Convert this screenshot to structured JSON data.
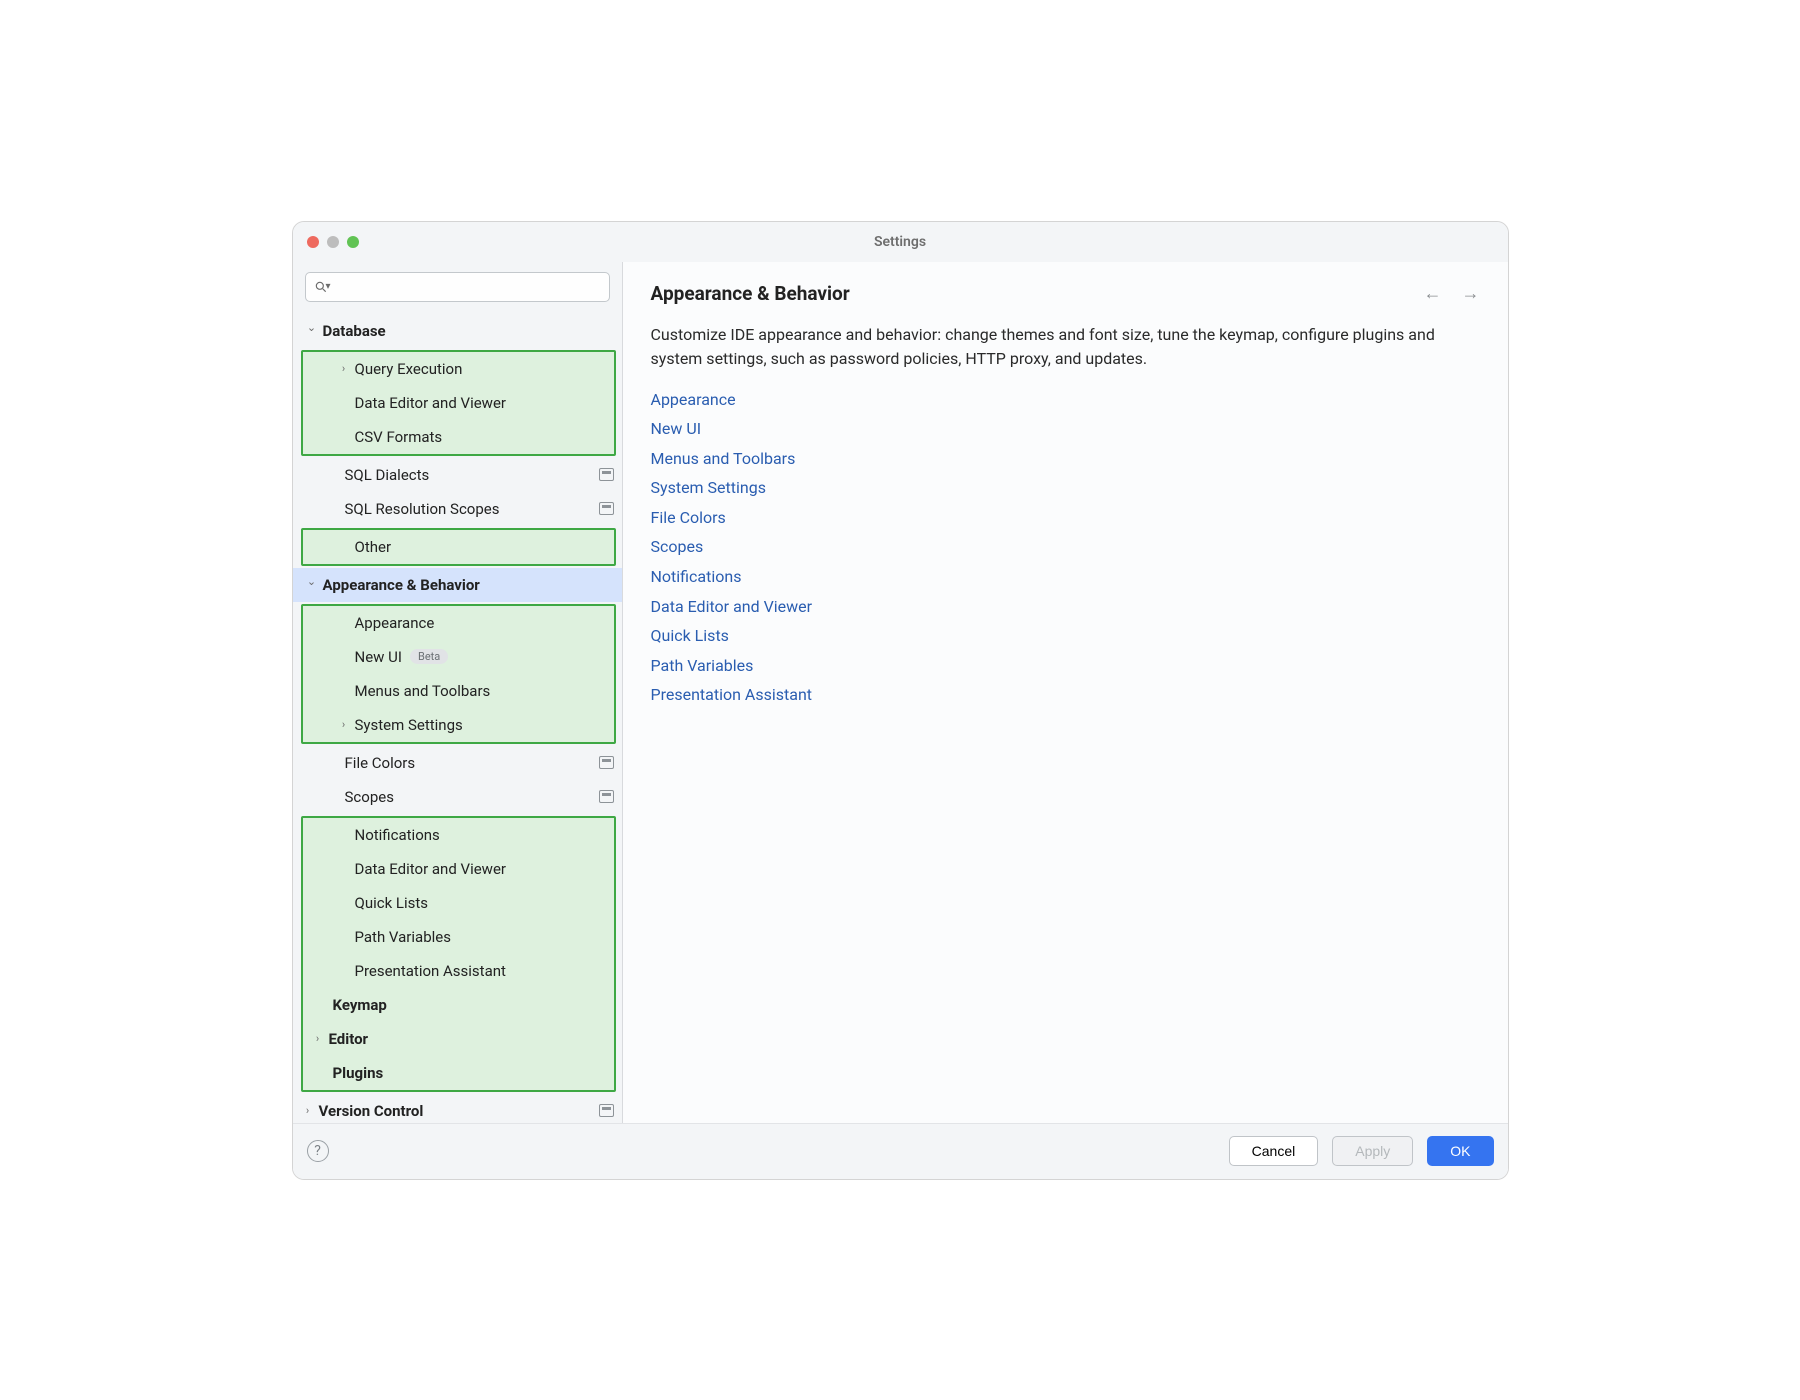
{
  "window": {
    "title": "Settings"
  },
  "search": {
    "placeholder": ""
  },
  "sidebar": {
    "database": {
      "label": "Database"
    },
    "query_execution": {
      "label": "Query Execution"
    },
    "data_editor_viewer": {
      "label": "Data Editor and Viewer"
    },
    "csv_formats": {
      "label": "CSV Formats"
    },
    "sql_dialects": {
      "label": "SQL Dialects"
    },
    "sql_resolution": {
      "label": "SQL Resolution Scopes"
    },
    "other": {
      "label": "Other"
    },
    "appearance_behavior": {
      "label": "Appearance & Behavior"
    },
    "appearance": {
      "label": "Appearance"
    },
    "new_ui": {
      "label": "New UI",
      "badge": "Beta"
    },
    "menus_toolbars": {
      "label": "Menus and Toolbars"
    },
    "system_settings": {
      "label": "System Settings"
    },
    "file_colors": {
      "label": "File Colors"
    },
    "scopes": {
      "label": "Scopes"
    },
    "notifications": {
      "label": "Notifications"
    },
    "data_editor_viewer2": {
      "label": "Data Editor and Viewer"
    },
    "quick_lists": {
      "label": "Quick Lists"
    },
    "path_variables": {
      "label": "Path Variables"
    },
    "presentation_assistant": {
      "label": "Presentation Assistant"
    },
    "keymap": {
      "label": "Keymap"
    },
    "editor": {
      "label": "Editor"
    },
    "plugins": {
      "label": "Plugins"
    },
    "version_control": {
      "label": "Version Control"
    }
  },
  "main": {
    "title": "Appearance & Behavior",
    "description": "Customize IDE appearance and behavior: change themes and font size, tune the keymap, configure plugins and system settings, such as password policies, HTTP proxy, and updates.",
    "links": {
      "l0": "Appearance",
      "l1": "New UI",
      "l2": "Menus and Toolbars",
      "l3": "System Settings",
      "l4": "File Colors",
      "l5": "Scopes",
      "l6": "Notifications",
      "l7": "Data Editor and Viewer",
      "l8": "Quick Lists",
      "l9": "Path Variables",
      "l10": "Presentation Assistant"
    }
  },
  "footer": {
    "cancel": "Cancel",
    "apply": "Apply",
    "ok": "OK"
  }
}
